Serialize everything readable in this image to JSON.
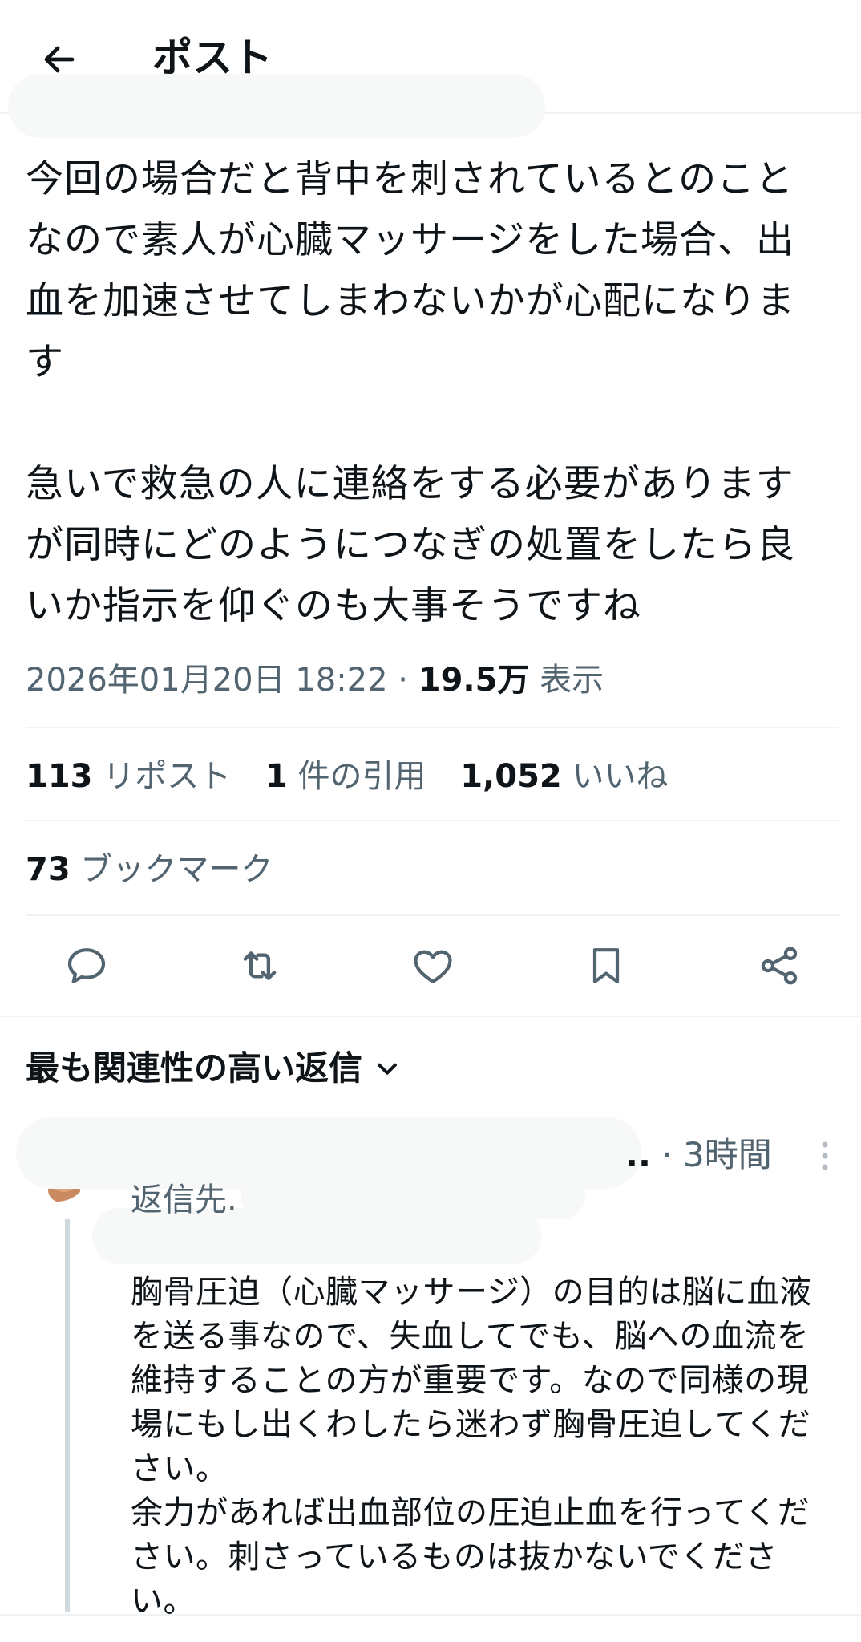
{
  "header": {
    "title": "ポスト"
  },
  "tweet": {
    "text": "今回の場合だと背中を刺されているとのこと\nなので素人が心臓マッサージをした場合、出\n血を加速させてしまわないかが心配になりま\nす\n\n急いで救急の人に連絡をする必要があります\nが同時にどのようにつなぎの処置をしたら良\nいか指示を仰ぐのも大事そうですね",
    "timestamp": "2026年01月20日 18:22",
    "dot": " · ",
    "views_count": "19.5万",
    "views_label": "表示"
  },
  "stats": {
    "reposts_count": "113",
    "reposts_label": "リポスト",
    "quotes_count": "1",
    "quotes_label": "件の引用",
    "likes_count": "1,052",
    "likes_label": "いいね",
    "bookmarks_count": "73",
    "bookmarks_label": "ブックマーク"
  },
  "actions": {
    "icons": [
      "reply-icon",
      "repost-icon",
      "like-icon",
      "bookmark-icon",
      "share-icon"
    ]
  },
  "replies": {
    "sort_label": "最も関連性の高い返信",
    "items": [
      {
        "name_tail": "..",
        "dot": " · ",
        "time": "3時間",
        "reply_to": "返信先.",
        "text": "胸骨圧迫（心臓マッサージ）の目的は脳に血液\nを送る事なので、失血してでも、脳への血流を\n維持することの方が重要です。なので同様の現\n場にもし出くわしたら迷わず胸骨圧迫してくだ\nさい。\n余力があれば出血部位の圧迫止血を行ってくだ\nさい。刺さっているものは抜かないでくださ\nい。"
      }
    ]
  },
  "colors": {
    "text": "#0f1419",
    "secondary": "#536471",
    "divider": "#eff3f4",
    "link": "#1d9bf0"
  }
}
